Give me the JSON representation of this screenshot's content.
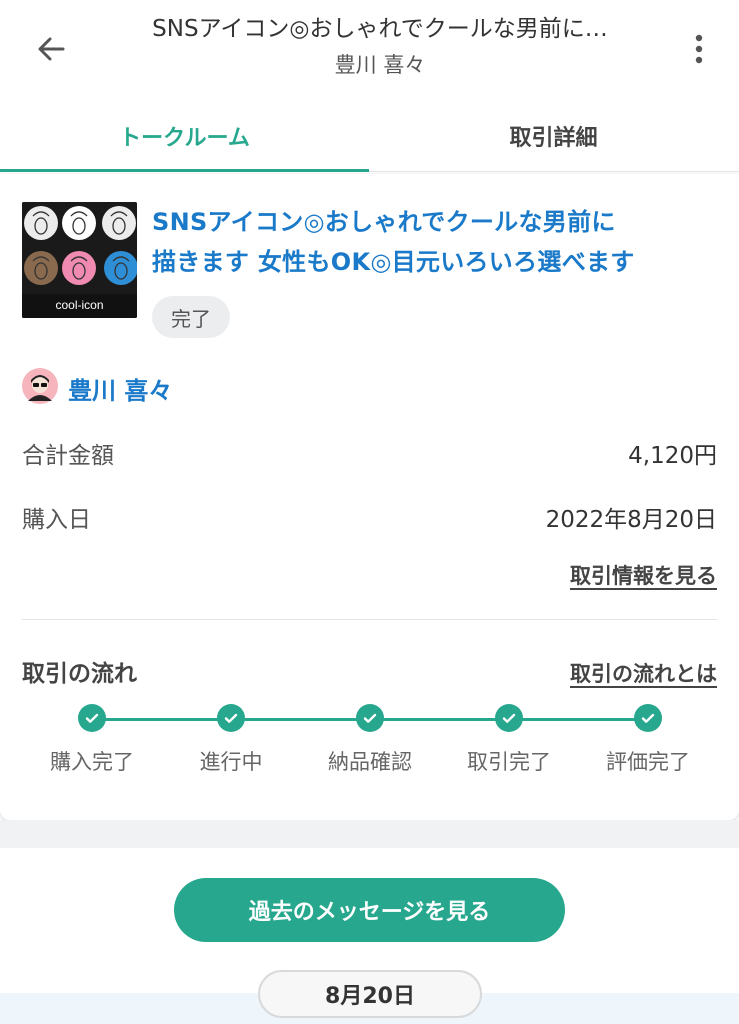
{
  "header": {
    "title": "SNSアイコン◎おしゃれでクールな男前に…",
    "subtitle": "豊川 喜々"
  },
  "tabs": [
    {
      "label": "トークルーム",
      "active": true
    },
    {
      "label": "取引詳細",
      "active": false
    }
  ],
  "service": {
    "thumbnail_caption": "cool-icon",
    "title_line1": "SNSアイコン◎おしゃれでクールな男前に",
    "title_line2": "描きます 女性もOK◎目元いろいろ選べます",
    "status": "完了"
  },
  "seller": {
    "name": "豊川 喜々"
  },
  "details": {
    "total_label": "合計金額",
    "total_value": "4,120円",
    "purchase_label": "購入日",
    "purchase_value": "2022年8月20日",
    "info_link": "取引情報を見る"
  },
  "flow": {
    "title": "取引の流れ",
    "link": "取引の流れとは",
    "steps": [
      "購入完了",
      "進行中",
      "納品確認",
      "取引完了",
      "評価完了"
    ]
  },
  "messages": {
    "history_button": "過去のメッセージを見る",
    "date_chip": "8月20日"
  },
  "colors": {
    "accent": "#27a88e",
    "link_blue": "#1a7ac9"
  }
}
